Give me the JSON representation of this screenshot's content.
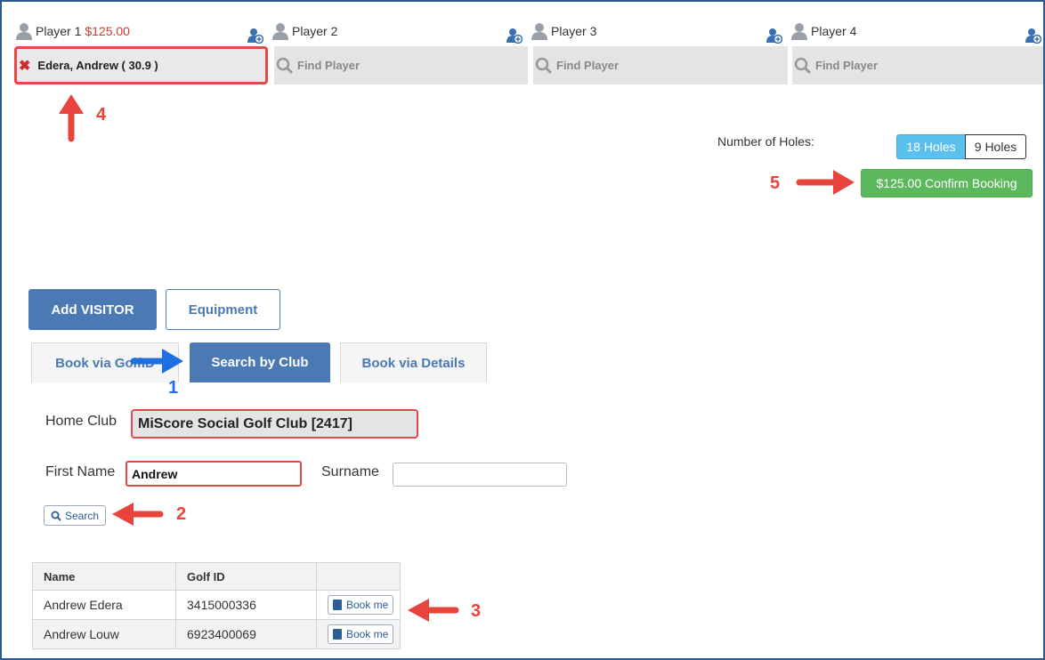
{
  "players": [
    {
      "label": "Player 1",
      "amount": "$125.00",
      "slot_text": "Edera, Andrew ( 30.9 )",
      "filled": true
    },
    {
      "label": "Player 2",
      "amount": "",
      "slot_text": "Find Player",
      "filled": false
    },
    {
      "label": "Player 3",
      "amount": "",
      "slot_text": "Find Player",
      "filled": false
    },
    {
      "label": "Player 4",
      "amount": "",
      "slot_text": "Find Player",
      "filled": false
    }
  ],
  "holes": {
    "label": "Number of Holes:",
    "option_18": "18 Holes",
    "option_9": "9 Holes",
    "selected": "18 Holes"
  },
  "confirm": {
    "label": "$125.00 Confirm Booking"
  },
  "actions": {
    "add_visitor": "Add VISITOR",
    "equipment": "Equipment"
  },
  "tabs": [
    "Book via GolfID",
    "Search by Club",
    "Book via Details"
  ],
  "active_tab": "Search by Club",
  "form": {
    "home_club_label": "Home Club",
    "home_club_value": "MiScore Social Golf Club [2417]",
    "first_name_label": "First Name",
    "first_name_value": "Andrew",
    "surname_label": "Surname",
    "surname_value": "",
    "search_label": "Search"
  },
  "results": {
    "columns": [
      "Name",
      "Golf ID",
      ""
    ],
    "rows": [
      {
        "name": "Andrew Edera",
        "golf_id": "3415000336",
        "action": "Book me"
      },
      {
        "name": "Andrew Louw",
        "golf_id": "6923400069",
        "action": "Book me"
      }
    ]
  },
  "annotations": {
    "a1": "1",
    "a2": "2",
    "a3": "3",
    "a4": "4",
    "a5": "5"
  },
  "colors": {
    "accent_blue": "#4a79b4",
    "highlight_red": "#e24a4a",
    "confirm_green": "#5cb85c",
    "selected_hole": "#5bc0ee"
  }
}
